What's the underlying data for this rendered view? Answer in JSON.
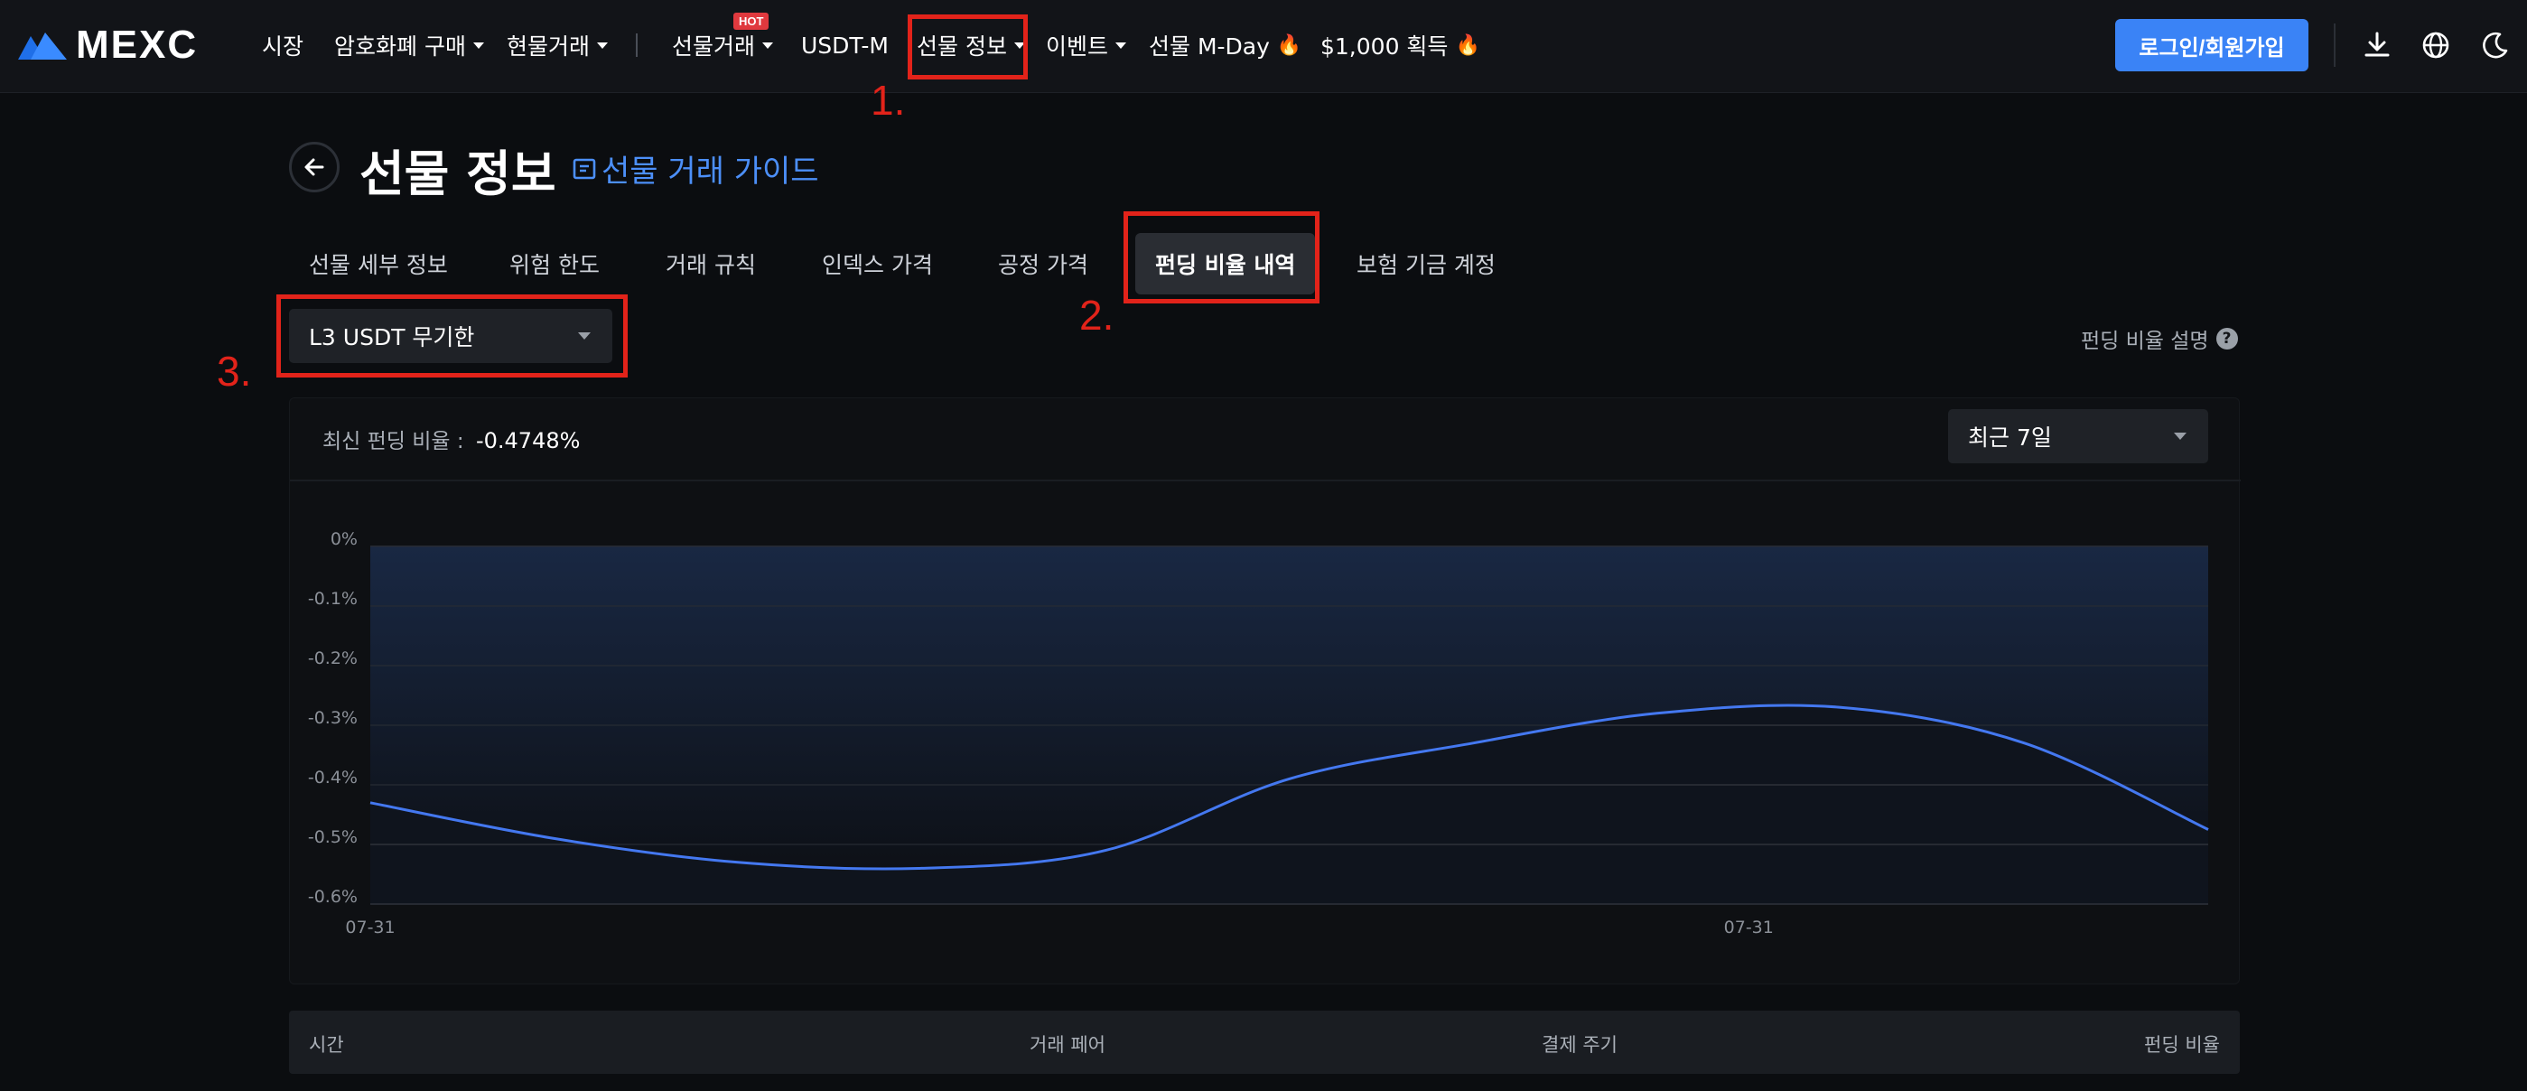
{
  "brand": {
    "logo_text": "MEXC",
    "accent": "#3a83f6"
  },
  "nav": {
    "items": [
      "시장",
      "암호화폐 구매",
      "현물거래",
      "선물거래",
      "USDT-M",
      "선물 정보",
      "이벤트",
      "선물 M-Day",
      "$1,000 획득"
    ],
    "hot_badge": "HOT",
    "login": "로그인/회원가입",
    "icons": [
      "download-icon",
      "globe-icon",
      "moon-icon"
    ]
  },
  "annotations": {
    "n1": "1.",
    "n2": "2.",
    "n3": "3.",
    "color": "#e2231a"
  },
  "page": {
    "title": "선물 정보",
    "guide": "선물 거래 가이드"
  },
  "tabs": [
    "선물 세부 정보",
    "위험 한도",
    "거래 규칙",
    "인덱스 가격",
    "공정 가격",
    "펀딩 비율 내역",
    "보험 기금 계정"
  ],
  "active_tab": "펀딩 비율 내역",
  "contract": {
    "selected": "L3 USDT 무기한"
  },
  "funding_explain": "펀딩 비율 설명",
  "card": {
    "latest_label": "최신 펀딩 비율 :",
    "latest_value": "-0.4748%",
    "range": "최근 7일"
  },
  "chart_data": {
    "type": "line",
    "x_tick_labels": [
      "07-31",
      "07-31"
    ],
    "y_tick_labels": [
      "0%",
      "-0.1%",
      "-0.2%",
      "-0.3%",
      "-0.4%",
      "-0.5%",
      "-0.6%"
    ],
    "ylim": [
      -0.6,
      0
    ],
    "grid": true,
    "line_color": "#4478f0",
    "x": [
      0,
      1,
      2,
      3,
      4,
      5,
      6,
      7,
      8,
      9,
      10
    ],
    "values": [
      -0.43,
      -0.49,
      -0.53,
      -0.54,
      -0.51,
      -0.39,
      -0.33,
      -0.28,
      -0.27,
      -0.33,
      -0.475
    ]
  },
  "table": {
    "headers": [
      "시간",
      "거래 페어",
      "결제 주기",
      "펀딩 비율"
    ]
  }
}
